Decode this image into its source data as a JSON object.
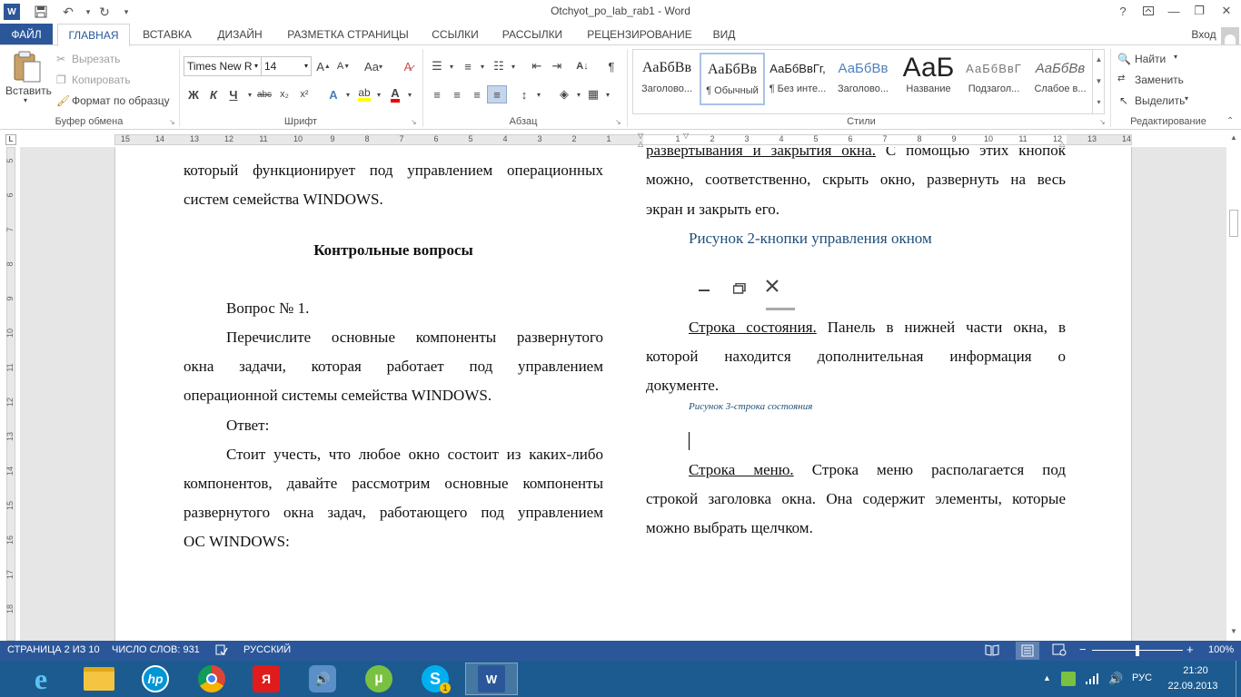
{
  "window": {
    "title": "Otchyot_po_lab_rab1 - Word",
    "help": "?",
    "login": "Вход"
  },
  "tabs": [
    {
      "label": "ФАЙЛ"
    },
    {
      "label": "ГЛАВНАЯ"
    },
    {
      "label": "ВСТАВКА"
    },
    {
      "label": "ДИЗАЙН"
    },
    {
      "label": "РАЗМЕТКА СТРАНИЦЫ"
    },
    {
      "label": "ССЫЛКИ"
    },
    {
      "label": "РАССЫЛКИ"
    },
    {
      "label": "РЕЦЕНЗИРОВАНИЕ"
    },
    {
      "label": "ВИД"
    }
  ],
  "ribbon": {
    "clipboard": {
      "paste": "Вставить",
      "cut": "Вырезать",
      "copy": "Копировать",
      "format_painter": "Формат по образцу",
      "group": "Буфер обмена"
    },
    "font": {
      "name": "Times New R",
      "size": "14",
      "grow": "A",
      "shrink": "A",
      "case": "Aa",
      "bold": "Ж",
      "italic": "К",
      "underline": "Ч",
      "strike": "abc",
      "sub": "x₂",
      "sup": "x²",
      "group": "Шрифт"
    },
    "paragraph": {
      "group": "Абзац"
    },
    "styles": {
      "items": [
        {
          "preview": "АаБбВв",
          "name": "Заголово..."
        },
        {
          "preview": "АаБбВв",
          "name": "¶ Обычный"
        },
        {
          "preview": "АаБбВвГг,",
          "name": "¶ Без инте..."
        },
        {
          "preview": "АаБбВв",
          "name": "Заголово..."
        },
        {
          "preview": "АаБ",
          "name": "Название"
        },
        {
          "preview": "АаБбВвГ",
          "name": "Подзагол..."
        },
        {
          "preview": "АаБбВв",
          "name": "Слабое в..."
        }
      ],
      "group": "Стили"
    },
    "editing": {
      "find": "Найти",
      "replace": "Заменить",
      "select": "Выделить",
      "group": "Редактирование"
    }
  },
  "ruler": {
    "h_numbers": [
      "15",
      "14",
      "13",
      "12",
      "11",
      "10",
      "9",
      "8",
      "7",
      "6",
      "5",
      "4",
      "3",
      "2",
      "1",
      "1",
      "2",
      "3",
      "4",
      "5",
      "6",
      "7",
      "8",
      "9",
      "10",
      "11",
      "12",
      "13",
      "14"
    ],
    "v_numbers": [
      "5",
      "6",
      "7",
      "8",
      "9",
      "10",
      "11",
      "12",
      "13",
      "14",
      "15",
      "16",
      "17",
      "18"
    ]
  },
  "document": {
    "left": {
      "line1": "который функционирует под управлением операционных",
      "line2": "систем семейства WINDOWS.",
      "heading": "Контрольные вопросы",
      "q": "Вопрос № 1.",
      "p1a": "Перечислите основные компоненты развернутого",
      "p1b": "окна задачи, которая работает под управлением",
      "p1c": "операционной системы семейства WINDOWS.",
      "ans": "Ответ:",
      "p2a": "Стоит учесть, что любое окно состоит из каких-либо",
      "p2b": "компонентов, давайте рассмотрим основные компоненты",
      "p2c": "развернутого окна задач, работающего под управлением",
      "p2d": "ОС WINDOWS:"
    },
    "right": {
      "top_underlined": "развертывания и закрытия окна.",
      "top_rest": " С помощью этих кнопок",
      "l2": "можно, соответственно, скрыть окно, развернуть на весь",
      "l3": "экран и закрыть его.",
      "caption2": "Рисунок 2-кнопки управления окном",
      "status_term": "Строка состояния.",
      "status_rest": " Панель в нижней части окна, в",
      "s2": "которой находится дополнительная информация о",
      "s3": "документе.",
      "caption3": "Рисунок 3-строка состояния",
      "menu_term": "Строка меню.",
      "menu_rest": " Строка меню располагается под",
      "m2": "строкой заголовка окна. Она содержит элементы, которые",
      "m3": "можно выбрать щелчком."
    }
  },
  "statusbar": {
    "page": "СТРАНИЦА 2 ИЗ 10",
    "words": "ЧИСЛО СЛОВ: 931",
    "lang": "РУССКИЙ",
    "zoom": "100%"
  },
  "taskbar": {
    "lang": "РУС",
    "time": "21:20",
    "date": "22.09.2013",
    "skype_badge": "1"
  },
  "colors": {
    "accent": "#2b579a",
    "taskbar": "#1c5b8f",
    "caption": "#1f4e79"
  }
}
